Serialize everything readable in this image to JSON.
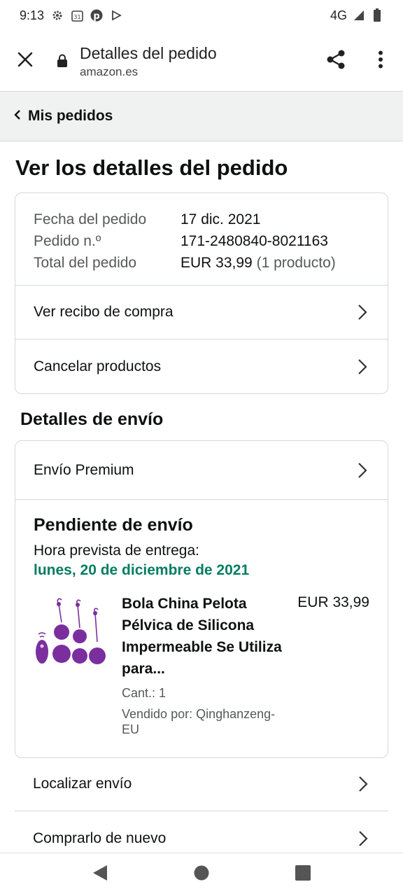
{
  "status_bar": {
    "time": "9:13",
    "left_icons": [
      "settings-icon",
      "calendar-icon",
      "pinterest-icon",
      "play-store-icon"
    ],
    "calendar_day": "31",
    "network": "4G",
    "right_icons": [
      "signal-icon",
      "battery-icon"
    ]
  },
  "browser": {
    "title": "Detalles del pedido",
    "host": "amazon.es",
    "icons": [
      "close-icon",
      "lock-icon",
      "share-icon",
      "more-vert-icon"
    ]
  },
  "breadcrumb": {
    "back_label": "Mis pedidos"
  },
  "page": {
    "heading": "Ver los detalles del pedido"
  },
  "order_summary": {
    "rows": [
      {
        "key": "Fecha del pedido",
        "value": "17 dic. 2021"
      },
      {
        "key": "Pedido n.º",
        "value": "171-2480840-8021163"
      },
      {
        "key": "Total del pedido",
        "value": "EUR 33,99",
        "extra": "(1 producto)"
      }
    ],
    "links": [
      "Ver recibo de compra",
      "Cancelar productos"
    ]
  },
  "shipping": {
    "section_title": "Detalles de envío",
    "method": "Envío Premium",
    "status": "Pendiente de envío",
    "eta_label": "Hora prevista de entrega:",
    "eta_date": "lunes, 20 de diciembre de 2021",
    "eta_color": "#067d62",
    "product": {
      "name": "Bola China Pelota Pélvica de Silicona Impermeable Se Utiliza para...",
      "quantity": "Cant.: 1",
      "seller": "Vendido por: Qinghanzeng-EU",
      "price": "EUR 33,99",
      "image_color": "#7b2f9e"
    }
  },
  "actions": [
    "Localizar envío",
    "Comprarlo de nuevo"
  ],
  "nav": {
    "icons": [
      "back-triangle-icon",
      "home-circle-icon",
      "recents-square-icon"
    ]
  }
}
